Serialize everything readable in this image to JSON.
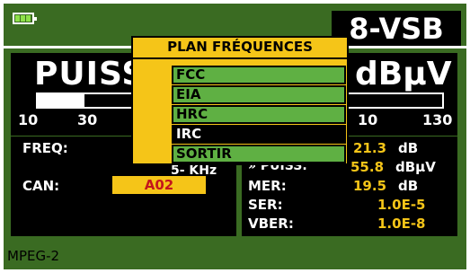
{
  "header": {
    "standard_badge": "8-VSB"
  },
  "measure": {
    "title_left": "PUISS",
    "title_right": "dBµV",
    "bar_level_fraction": 0.12,
    "scale": [
      "10",
      "30",
      "10",
      "130"
    ]
  },
  "left_panel": {
    "freq_label": "FREQ:",
    "freq_partial": "5- KHz",
    "can_label": "CAN:",
    "can_value": "A02"
  },
  "right_panel": {
    "row1_value": "21.3",
    "row1_unit": "dB",
    "row2_partial_label": "» PUISS:",
    "row2_value": "55.8",
    "row2_unit": "dBµV",
    "mer_label": "MER:",
    "mer_value": "19.5",
    "mer_unit": "dB",
    "ser_label": "SER:",
    "ser_value": "1.0E-5",
    "vber_label": "VBER:",
    "vber_value": "1.0E-8"
  },
  "menu": {
    "title": "PLAN FRÉQUENCES",
    "items": [
      {
        "label": "FCC",
        "selected": false
      },
      {
        "label": "EIA",
        "selected": false
      },
      {
        "label": "HRC",
        "selected": false
      },
      {
        "label": "IRC",
        "selected": true
      },
      {
        "label": "SORTIR",
        "selected": false
      }
    ]
  },
  "footer": {
    "mode": "MPEG-2"
  },
  "colors": {
    "screen_green": "#3a6b22",
    "item_green": "#5fb043",
    "highlight_yellow": "#f5c518",
    "can_red": "#c4161c"
  }
}
